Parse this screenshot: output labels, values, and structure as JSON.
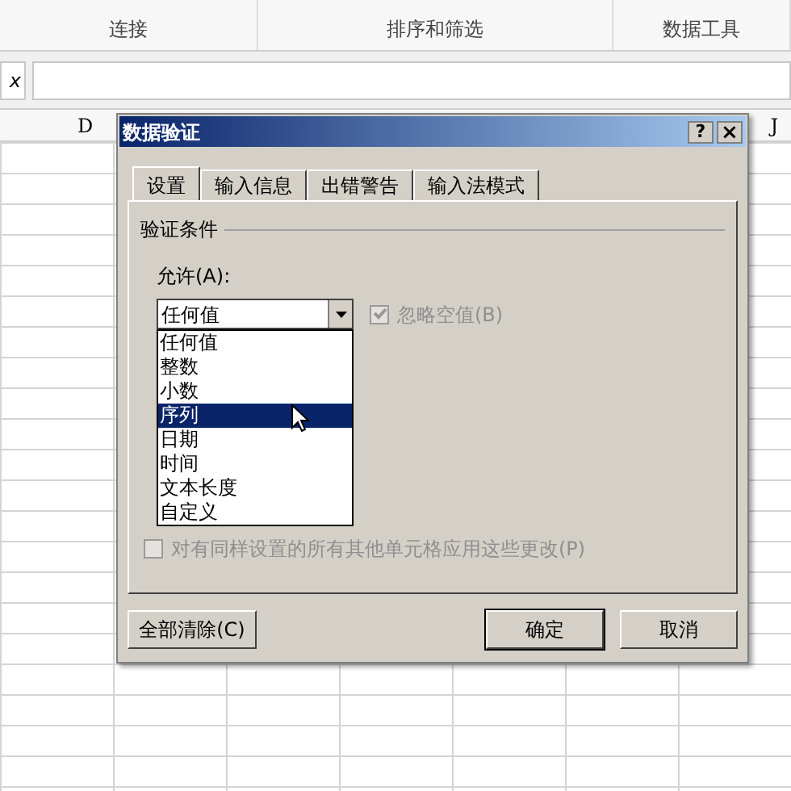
{
  "ribbon": {
    "groups": [
      "连接",
      "排序和筛选",
      "数据工具"
    ]
  },
  "formula_bar": {
    "label": "x"
  },
  "column_headers": [
    "D",
    "J"
  ],
  "dialog": {
    "title": "数据验证",
    "help": "?",
    "close": "×",
    "tabs": [
      {
        "label": "设置",
        "selected": true
      },
      {
        "label": "输入信息",
        "selected": false
      },
      {
        "label": "出错警告",
        "selected": false
      },
      {
        "label": "输入法模式",
        "selected": false
      }
    ],
    "group_title": "验证条件",
    "allow_label": "允许(A):",
    "allow_value": "任何值",
    "ignore_blank": {
      "label": "忽略空值(B)",
      "checked": true,
      "disabled": true
    },
    "options": [
      {
        "label": "任何值",
        "selected": false
      },
      {
        "label": "整数",
        "selected": false
      },
      {
        "label": "小数",
        "selected": false
      },
      {
        "label": "序列",
        "selected": true
      },
      {
        "label": "日期",
        "selected": false
      },
      {
        "label": "时间",
        "selected": false
      },
      {
        "label": "文本长度",
        "selected": false
      },
      {
        "label": "自定义",
        "selected": false
      }
    ],
    "apply_all": {
      "label": "对有同样设置的所有其他单元格应用这些更改(P)",
      "checked": false,
      "disabled": true
    },
    "buttons": [
      {
        "label": "全部清除(C)",
        "kind": "left"
      },
      {
        "label": "确定",
        "kind": "default"
      },
      {
        "label": "取消",
        "kind": "normal"
      }
    ]
  }
}
